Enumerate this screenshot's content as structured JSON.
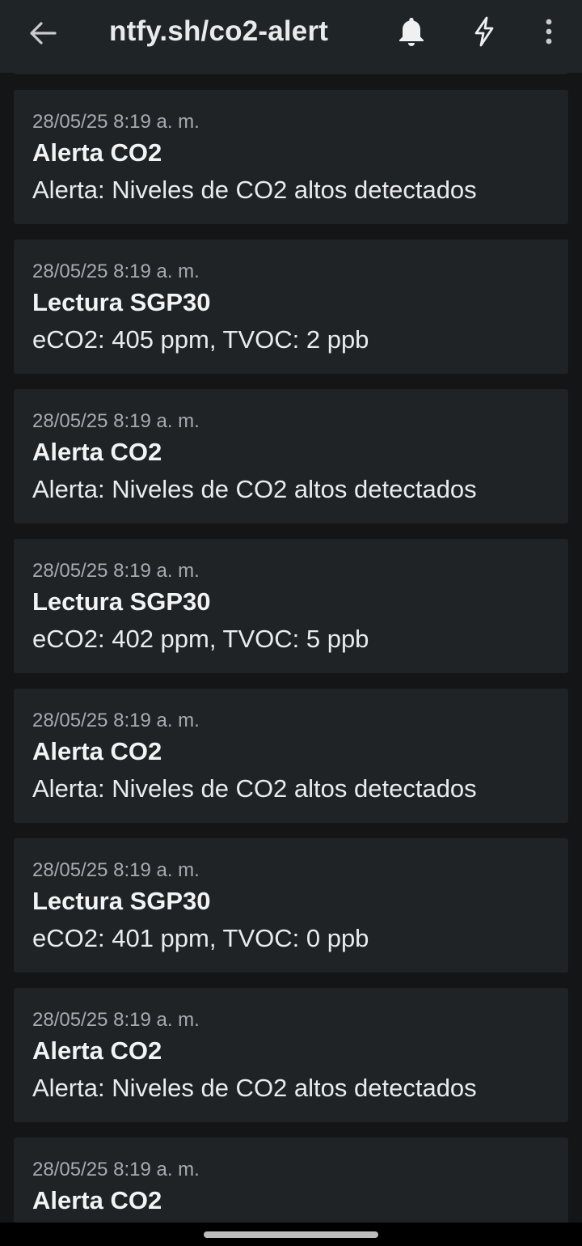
{
  "appbar": {
    "title": "ntfy.sh/co2-alert",
    "back_icon": "arrow-left-icon",
    "bell_icon": "bell-icon",
    "bolt_icon": "lightning-bolt-icon",
    "more_icon": "more-vertical-icon"
  },
  "colors": {
    "background": "#131517",
    "appbar": "#1f2427",
    "card": "#1f2326",
    "timestamp": "#a7abaf",
    "text": "#f1f3f4"
  },
  "notifications": [
    {
      "time": "28/05/25 8:19 a. m.",
      "title": "Alerta CO2",
      "message": "Alerta: Niveles de CO2 altos detectados"
    },
    {
      "time": "28/05/25 8:19 a. m.",
      "title": "Lectura SGP30",
      "message": "eCO2: 405 ppm, TVOC: 2 ppb"
    },
    {
      "time": "28/05/25 8:19 a. m.",
      "title": "Alerta CO2",
      "message": "Alerta: Niveles de CO2 altos detectados"
    },
    {
      "time": "28/05/25 8:19 a. m.",
      "title": "Lectura SGP30",
      "message": "eCO2: 402 ppm, TVOC: 5 ppb"
    },
    {
      "time": "28/05/25 8:19 a. m.",
      "title": "Alerta CO2",
      "message": "Alerta: Niveles de CO2 altos detectados"
    },
    {
      "time": "28/05/25 8:19 a. m.",
      "title": "Lectura SGP30",
      "message": "eCO2: 401 ppm, TVOC: 0 ppb"
    },
    {
      "time": "28/05/25 8:19 a. m.",
      "title": "Alerta CO2",
      "message": "Alerta: Niveles de CO2 altos detectados"
    },
    {
      "time": "28/05/25 8:19 a. m.",
      "title": "Alerta CO2",
      "message": ""
    }
  ]
}
